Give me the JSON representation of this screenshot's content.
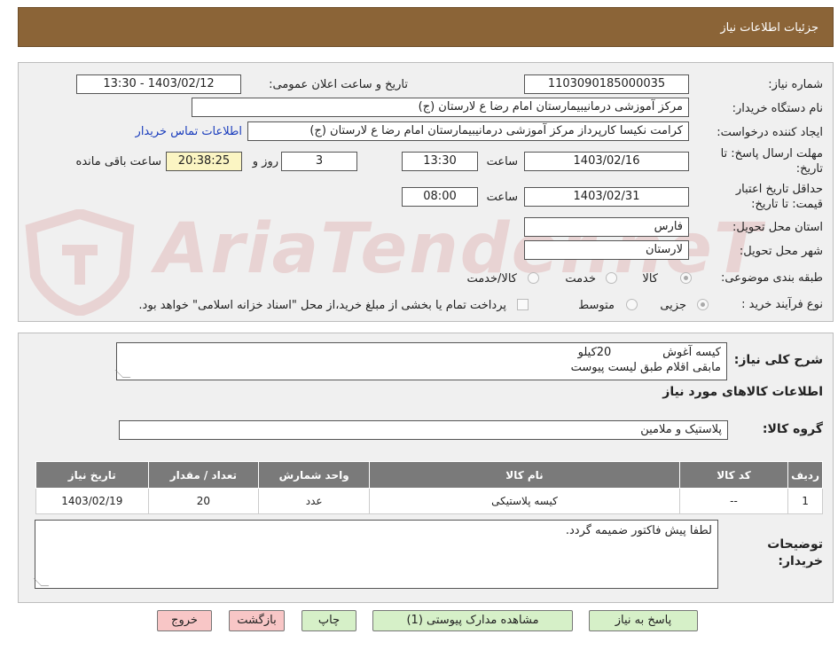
{
  "header": {
    "title": "جزئیات اطلاعات نیاز"
  },
  "form": {
    "need_number_label": "شماره نیاز:",
    "need_number": "1103090185000035",
    "announce_label": "تاریخ و ساعت اعلان عمومی:",
    "announce_value": "1403/02/12 - 13:30",
    "buyer_org_label": "نام دستگاه خریدار:",
    "buyer_org": "مرکز آموزشی درمانیبیمارستان امام رضا  ع  لارستان (ج)",
    "requester_label": "ایجاد کننده درخواست:",
    "requester": "کرامت نکیسا کارپرداز مرکز آموزشی درمانیبیمارستان امام رضا  ع  لارستان (ج)",
    "contact_link": "اطلاعات تماس خریدار",
    "deadline_label_1": "مهلت ارسال پاسخ: تا",
    "deadline_label_2": "تاریخ:",
    "deadline_date": "1403/02/16",
    "time_label": "ساعت",
    "deadline_time": "13:30",
    "days_value": "3",
    "days_label": "روز و",
    "remaining_time": "20:38:25",
    "remaining_label": "ساعت باقی مانده",
    "validity_label_1": "حداقل تاریخ اعتبار",
    "validity_label_2": "قیمت: تا تاریخ:",
    "validity_date": "1403/02/31",
    "validity_time": "08:00",
    "province_label": "استان محل تحویل:",
    "province": "فارس",
    "city_label": "شهر محل تحویل:",
    "city": "لارستان",
    "category_label": "طبقه بندی موضوعی:",
    "cat_goods": "کالا",
    "cat_service": "خدمت",
    "cat_goods_service": "کالا/خدمت",
    "process_label": "نوع فرآیند خرید :",
    "proc_partial": "جزیی",
    "proc_medium": "متوسط",
    "payment_note": "پرداخت تمام یا بخشی از مبلغ خرید،از محل \"اسناد خزانه اسلامی\" خواهد بود."
  },
  "details": {
    "summary_label": "شرح کلی نیاز:",
    "summary_line1": "کیسه آغوش              20کیلو",
    "summary_line2": "مابقی اقلام طبق لیست پیوست",
    "goods_info_title": "اطلاعات کالاهای مورد نیاز",
    "goods_group_label": "گروه کالا:",
    "goods_group": "پلاستیک و ملامین",
    "table": {
      "headers": [
        "ردیف",
        "کد کالا",
        "نام کالا",
        "واحد شمارش",
        "تعداد / مقدار",
        "تاریخ نیاز"
      ],
      "rows": [
        [
          "1",
          "--",
          "کیسه پلاستیکی",
          "عدد",
          "20",
          "1403/02/19"
        ]
      ]
    },
    "buyer_notes_label_1": "توضیحات",
    "buyer_notes_label_2": "خریدار:",
    "buyer_notes": "لطفا پیش فاکتور ضمیمه گردد."
  },
  "buttons": {
    "reply": "پاسخ به نیاز",
    "view_docs": "مشاهده مدارک پیوستی (1)",
    "print": "چاپ",
    "back": "بازگشت",
    "exit": "خروج"
  },
  "watermark_text": "AriaTender.neT",
  "colors": {
    "header_bg": "#8b6437",
    "button_green": "#d6f0c8",
    "button_red": "#f8c6c6",
    "remaining_bg": "#fbf5c3",
    "link": "#1a3dbd"
  }
}
